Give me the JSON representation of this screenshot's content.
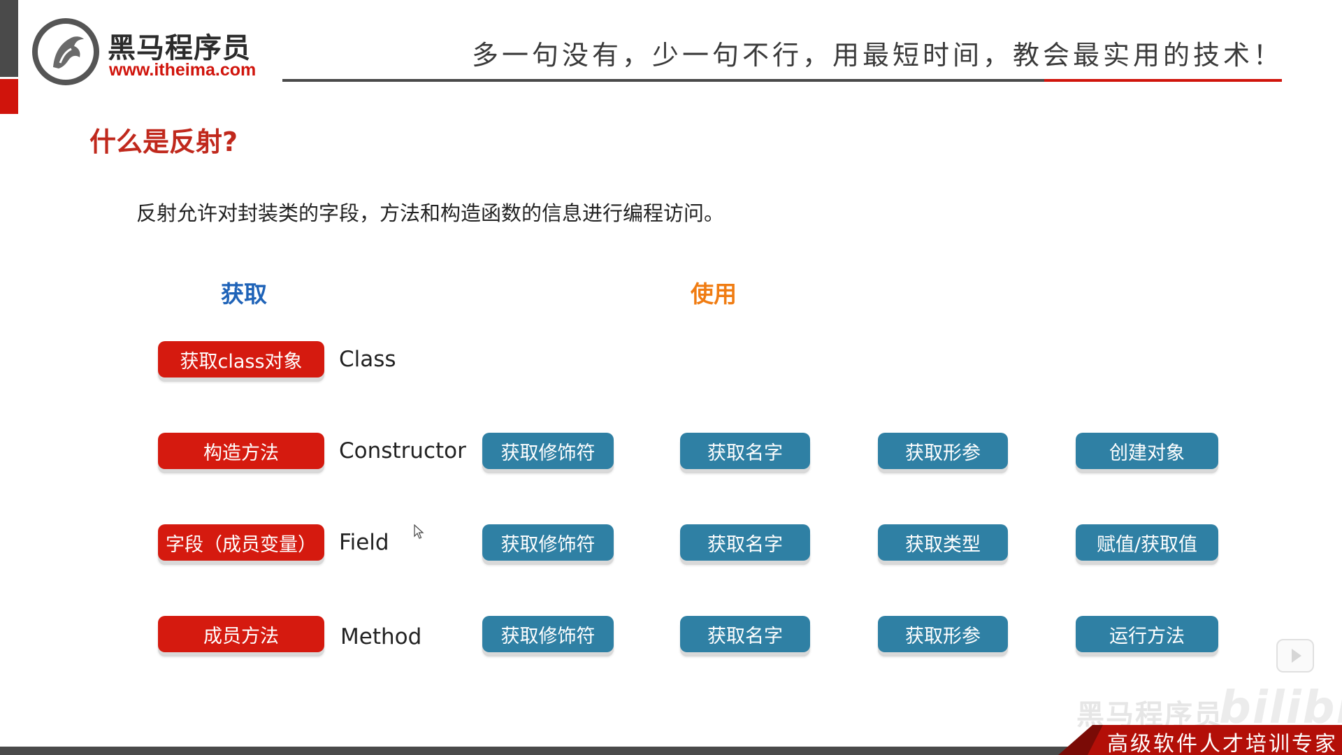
{
  "header": {
    "logo_name": "黑马程序员",
    "logo_url": "www.itheima.com",
    "slogan": "多一句没有，少一句不行，用最短时间，教会最实用的技术！"
  },
  "content": {
    "title": "什么是反射?",
    "definition": "反射允许对封装类的字段，方法和构造函数的信息进行编程访问。",
    "headings": {
      "obtain": "获取",
      "use": "使用"
    },
    "rows": [
      {
        "obtain": "获取class对象",
        "type": "Class",
        "actions": []
      },
      {
        "obtain": "构造方法",
        "type": "Constructor",
        "actions": [
          "获取修饰符",
          "获取名字",
          "获取形参",
          "创建对象"
        ]
      },
      {
        "obtain": "字段（成员变量）",
        "type": "Field",
        "actions": [
          "获取修饰符",
          "获取名字",
          "获取类型",
          "赋值/获取值"
        ]
      },
      {
        "obtain": "成员方法",
        "type": "Method",
        "actions": [
          "获取修饰符",
          "获取名字",
          "获取形参",
          "运行方法"
        ]
      }
    ]
  },
  "footer": {
    "slogan": "高级软件人才培训专家",
    "watermark": "黑马程序员",
    "watermark_site": "bilibili"
  },
  "colors": {
    "brand_red": "#d51a0f",
    "action_blue": "#2f80a4",
    "heading_blue": "#1f63b8",
    "heading_orange": "#f07c12",
    "dark_gray": "#4a4a4a"
  },
  "icons": {
    "logo": "horse-head-logo-icon",
    "cursor": "mouse-pointer-icon",
    "player": "video-player-icon"
  }
}
